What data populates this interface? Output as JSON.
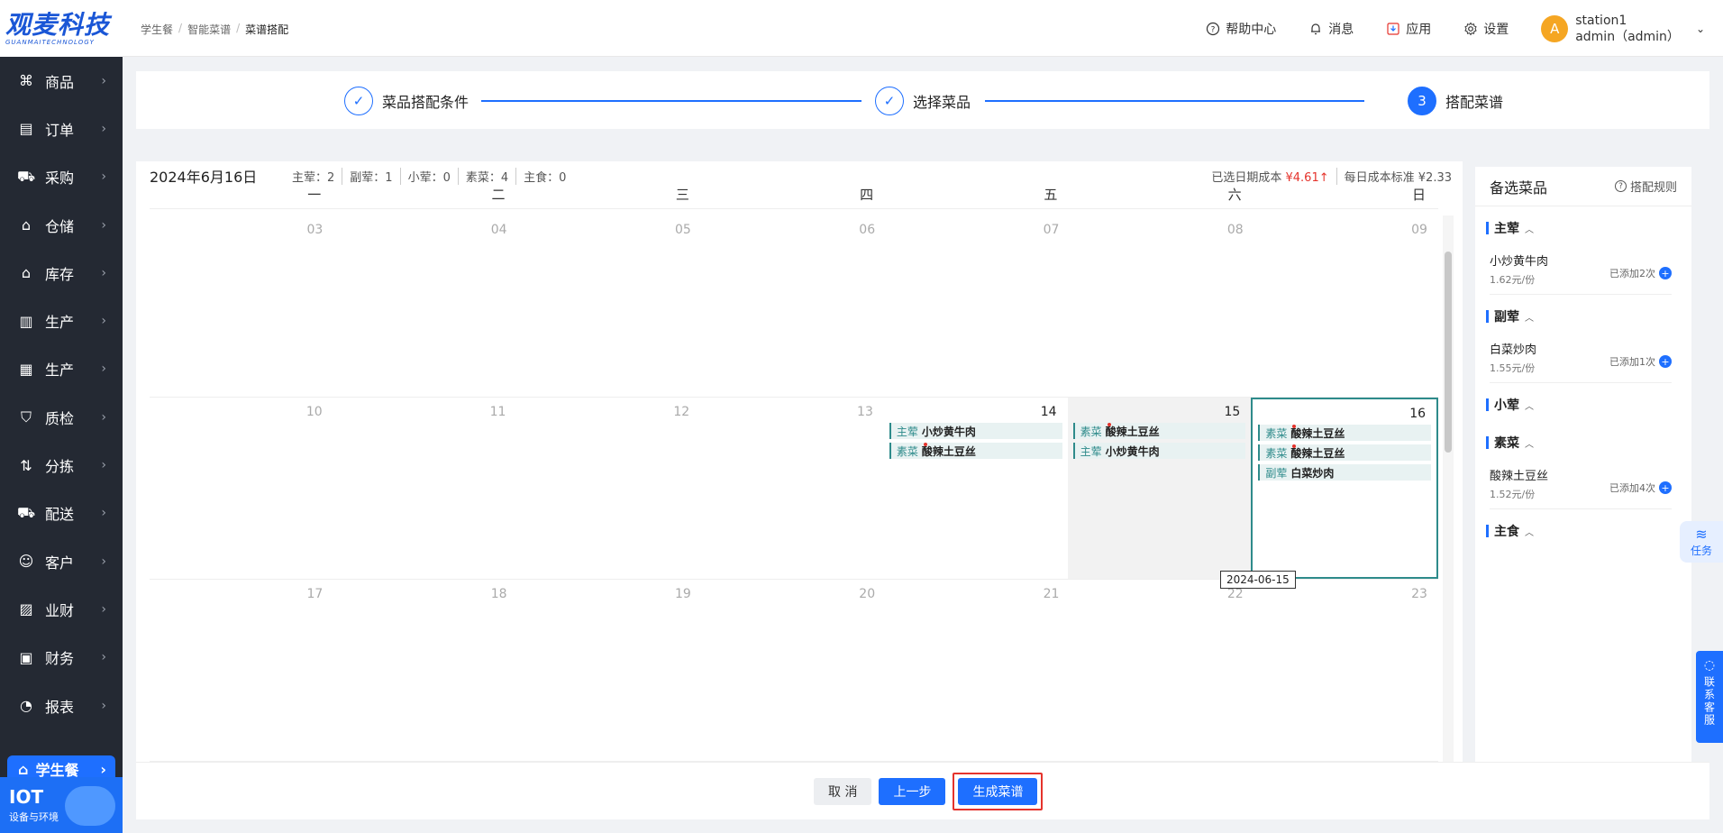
{
  "logo": {
    "main": "观麦科技",
    "sub": "GUANMAITECHNOLOGY"
  },
  "sidebar": {
    "items": [
      {
        "label": "商品",
        "icon": "grid-icon"
      },
      {
        "label": "订单",
        "icon": "order-icon"
      },
      {
        "label": "采购",
        "icon": "cart-icon"
      },
      {
        "label": "仓储",
        "icon": "warehouse-icon"
      },
      {
        "label": "库存",
        "icon": "inventory-icon"
      },
      {
        "label": "生产",
        "icon": "factory-icon"
      },
      {
        "label": "生产",
        "icon": "chart-icon"
      },
      {
        "label": "质检",
        "icon": "shield-icon"
      },
      {
        "label": "分拣",
        "icon": "sort-icon"
      },
      {
        "label": "配送",
        "icon": "truck-icon"
      },
      {
        "label": "客户",
        "icon": "user-icon"
      },
      {
        "label": "业财",
        "icon": "finance-icon"
      },
      {
        "label": "财务",
        "icon": "money-icon"
      },
      {
        "label": "报表",
        "icon": "report-icon"
      }
    ],
    "active": {
      "label": "学生餐",
      "icon": "student-meal-icon"
    },
    "iot": {
      "title": "IOT",
      "sub": "设备与环境"
    }
  },
  "header": {
    "breadcrumb": [
      "学生餐",
      "智能菜谱",
      "菜谱搭配"
    ],
    "help": "帮助中心",
    "messages": "消息",
    "apps": "应用",
    "settings": "设置",
    "avatar_letter": "A",
    "user_name": "station1",
    "user_role": "admin（admin）"
  },
  "steps": [
    {
      "label": "菜品搭配条件",
      "state": "done"
    },
    {
      "label": "选择菜品",
      "state": "done"
    },
    {
      "label": "搭配菜谱",
      "state": "current",
      "num": "3"
    }
  ],
  "calendar": {
    "date": "2024年6月16日",
    "counts": [
      "主荤：2",
      "副荤：1",
      "小荤：0",
      "素菜：4",
      "主食：0"
    ],
    "cost_label": "已选日期成本",
    "cost_value": "¥4.61",
    "std_label": "每日成本标准",
    "std_value": "¥2.33",
    "weekdays": [
      "一",
      "二",
      "三",
      "四",
      "五",
      "六",
      "日"
    ],
    "weeks": [
      [
        "03",
        "04",
        "05",
        "06",
        "07",
        "08",
        "09"
      ],
      [
        "10",
        "11",
        "12",
        "13",
        "14",
        "15",
        "16"
      ],
      [
        "17",
        "18",
        "19",
        "20",
        "21",
        "22",
        "23"
      ]
    ],
    "meals": {
      "d14": [
        {
          "cat": "主荤",
          "name": "小炒黄牛肉",
          "dot": false
        },
        {
          "cat": "素菜",
          "name": "酸辣土豆丝",
          "dot": true
        }
      ],
      "d15": [
        {
          "cat": "素菜",
          "name": "酸辣土豆丝",
          "dot": true
        },
        {
          "cat": "主荤",
          "name": "小炒黄牛肉",
          "dot": false
        }
      ],
      "d16": [
        {
          "cat": "素菜",
          "name": "酸辣土豆丝",
          "dot": true
        },
        {
          "cat": "素菜",
          "name": "酸辣土豆丝",
          "dot": true
        },
        {
          "cat": "副荤",
          "name": "白菜炒肉",
          "dot": false
        }
      ]
    },
    "tooltip": "2024-06-15"
  },
  "side_panel": {
    "title": "备选菜品",
    "rule": "搭配规则",
    "categories": [
      {
        "name": "主荤",
        "items": [
          {
            "name": "小炒黄牛肉",
            "price": "1.62元/份",
            "added": "已添加2次"
          }
        ]
      },
      {
        "name": "副荤",
        "items": [
          {
            "name": "白菜炒肉",
            "price": "1.55元/份",
            "added": "已添加1次"
          }
        ]
      },
      {
        "name": "小荤",
        "items": []
      },
      {
        "name": "素菜",
        "items": [
          {
            "name": "酸辣土豆丝",
            "price": "1.52元/份",
            "added": "已添加4次"
          }
        ]
      },
      {
        "name": "主食",
        "items": []
      }
    ]
  },
  "footer": {
    "cancel": "取 消",
    "prev": "上一步",
    "generate": "生成菜谱"
  },
  "floats": {
    "task": "任务",
    "service": "联系客服"
  }
}
